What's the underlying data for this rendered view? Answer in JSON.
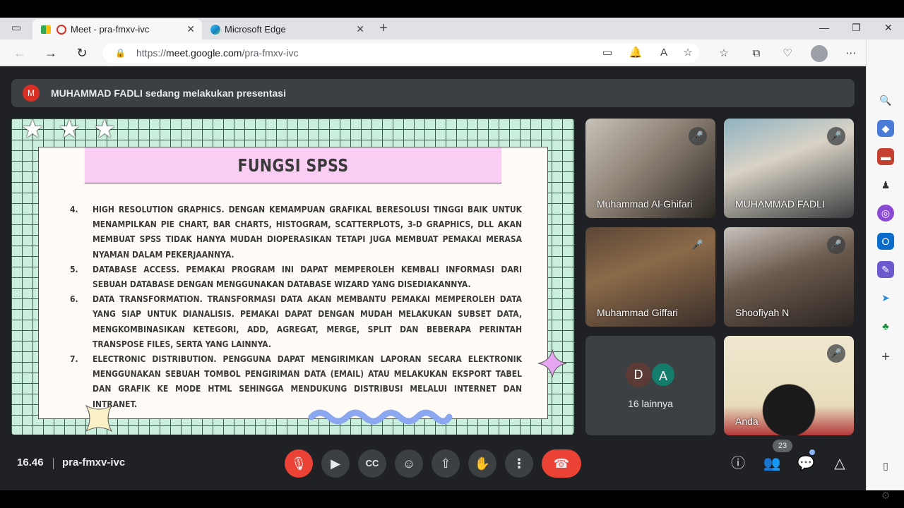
{
  "browser": {
    "tabs": [
      {
        "label": "Meet - pra-fmxv-ivc",
        "active": true
      },
      {
        "label": "Microsoft Edge",
        "active": false
      }
    ],
    "url_prefix": "https://",
    "url_host": "meet.google.com",
    "url_path": "/pra-fmxv-ivc"
  },
  "banner": {
    "avatar_letter": "M",
    "text": "MUHAMMAD FADLI sedang melakukan presentasi"
  },
  "slide": {
    "title": "FUNGSI SPSS",
    "items": [
      {
        "num": "4.",
        "text": "HIGH RESOLUTION GRAPHICS. DENGAN KEMAMPUAN GRAFIKAL BERESOLUSI TINGGI BAIK UNTUK MENAMPILKAN PIE CHART, BAR CHARTS, HISTOGRAM, SCATTERPLOTS, 3-D GRAPHICS, DLL AKAN MEMBUAT SPSS TIDAK HANYA MUDAH DIOPERASIKAN TETAPI JUGA MEMBUAT PEMAKAI MERASA NYAMAN DALAM PEKERJAANNYA."
      },
      {
        "num": "5.",
        "text": "DATABASE ACCESS. PEMAKAI PROGRAM INI DAPAT MEMPEROLEH KEMBALI INFORMASI DARI SEBUAH DATABASE DENGAN MENGGUNAKAN DATABASE WIZARD YANG DISEDIAKANNYA."
      },
      {
        "num": "6.",
        "text": "DATA TRANSFORMATION. TRANSFORMASI DATA AKAN MEMBANTU PEMAKAI MEMPEROLEH DATA YANG SIAP UNTUK DIANALISIS. PEMAKAI DAPAT DENGAN MUDAH MELAKUKAN SUBSET DATA, MENGKOMBINASIKAN KETEGORI, ADD, AGREGAT, MERGE, SPLIT DAN BEBERAPA PERINTAH TRANSPOSE FILES, SERTA YANG LAINNYA."
      },
      {
        "num": "7.",
        "text": "ELECTRONIC DISTRIBUTION. PENGGUNA DAPAT MENGIRIMKAN LAPORAN SECARA ELEKTRONIK MENGGUNAKAN SEBUAH TOMBOL PENGIRIMAN DATA (EMAIL) ATAU MELAKUKAN EKSPORT TABEL DAN GRAFIK KE MODE HTML SEHINGGA MENDUKUNG DISTRIBUSI MELALUI INTERNET DAN INTRANET."
      }
    ]
  },
  "participants": [
    {
      "name": "Muhammad Al-Ghifari",
      "muted": true
    },
    {
      "name": "MUHAMMAD FADLI",
      "muted": true
    },
    {
      "name": "Muhammad Giffari",
      "muted": true
    },
    {
      "name": "Shoofiyah N",
      "muted": true
    },
    {
      "name": "Anda",
      "muted": true
    }
  ],
  "others": {
    "avatars": [
      "D",
      "A"
    ],
    "label": "16 lainnya"
  },
  "footer": {
    "time": "16.46",
    "meeting_code": "pra-fmxv-ivc",
    "participant_count": "23"
  },
  "colors": {
    "meet_bg": "#202124",
    "end_call": "#ea4335",
    "slide_bg": "#c9eedc",
    "slide_header": "#f9cdf4"
  }
}
